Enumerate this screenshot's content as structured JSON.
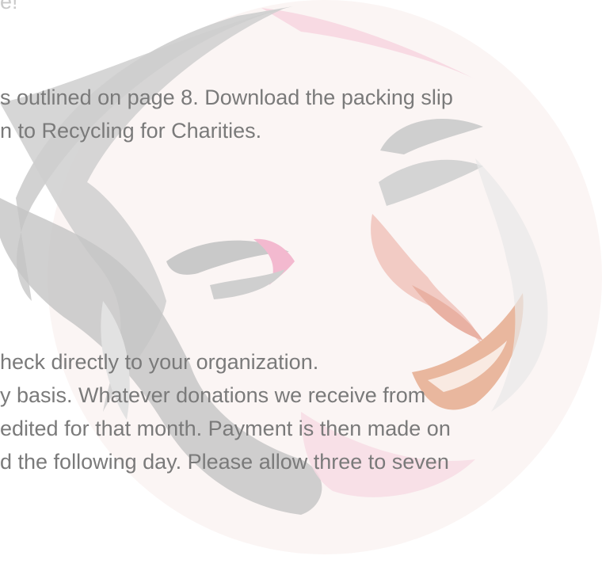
{
  "document": {
    "lines": {
      "top_fragment": "e!",
      "l1": "s outlined on page 8. Download the packing slip",
      "l2": "n to Recycling for Charities.",
      "l3": "heck directly to your organization.",
      "l4": "y basis. Whatever donations we receive from",
      "l5": "edited for that month. Payment is then made on",
      "l6": "d the following day. Please allow three to seven"
    }
  },
  "colors": {
    "text": "#7a7a7a",
    "art_gray": "#cfcfcf",
    "art_pink": "#f5c6d6",
    "art_tan": "#e9b79e",
    "art_bg": "#fbf4f3"
  },
  "art": {
    "icon": "woman-face-illustration-icon"
  }
}
